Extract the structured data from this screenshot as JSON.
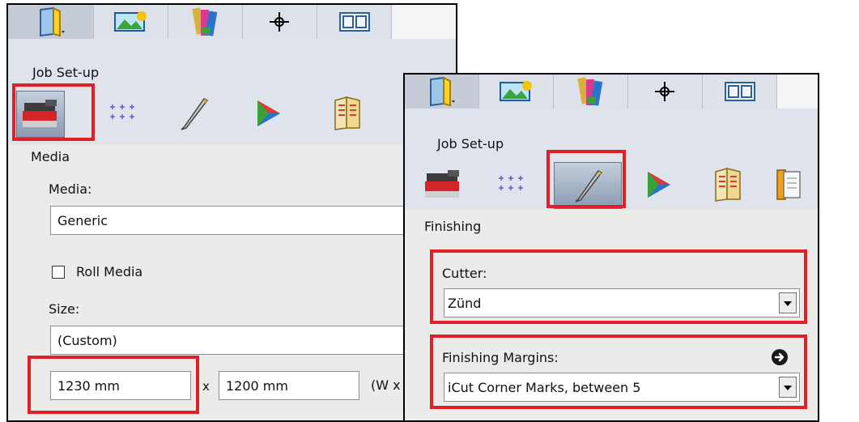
{
  "left_panel": {
    "section": "Job Set-up",
    "active_tab": "Media",
    "media_label": "Media:",
    "media_value": "Generic",
    "roll_media_label": "Roll Media",
    "size_label": "Size:",
    "size_value": "(Custom)",
    "width_value": "1230 mm",
    "times": "x",
    "height_value": "1200 mm",
    "wh_hint": "(W x"
  },
  "right_panel": {
    "section": "Job Set-up",
    "active_tab": "Finishing",
    "cutter_label": "Cutter:",
    "cutter_value": "Zünd",
    "margins_label": "Finishing Margins:",
    "margins_value": "iCut Corner Marks, between 5"
  },
  "colors": {
    "highlight": "#e01f26",
    "panel_bg": "#ebebea",
    "header_bg": "#dfe4ec"
  }
}
